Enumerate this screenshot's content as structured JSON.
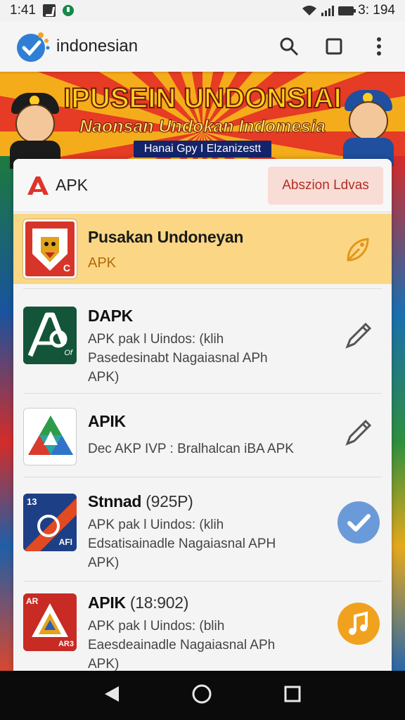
{
  "status_bar": {
    "time": "1:41",
    "clock_right": "3: 194",
    "icons": [
      "notification-icon",
      "whatsapp-icon",
      "wifi-icon",
      "signal-icon",
      "battery-icon"
    ]
  },
  "app_bar": {
    "title": "indonesian",
    "icons": [
      "app-logo-icon",
      "search-icon",
      "square-icon",
      "more-vert-icon"
    ]
  },
  "banner": {
    "title_line1": "IPUSEIN UNDONSIAI",
    "title_line2": "Naonsan Undokan Indomesia",
    "subtitle": "Hanai Gpy I Elzanizestt"
  },
  "card": {
    "header_label": "APK",
    "header_button": "Abszion Ldvas",
    "items": [
      {
        "title": "Pusakan Undoneyan",
        "suffix": "",
        "desc": [
          "APK"
        ],
        "action_icon": "tag-icon",
        "highlighted": true
      },
      {
        "title": "DAPK",
        "suffix": "",
        "desc": [
          "APK  pak l Uindos: (klih",
          "Pasedesinabt Nagaiasnal APh",
          "APK)"
        ],
        "action_icon": "pencil-icon"
      },
      {
        "title": "APIK",
        "suffix": "",
        "desc": [
          "Dec AKP IVP : Bralhalcan iBA APK"
        ],
        "action_icon": "pencil-icon"
      },
      {
        "title": "Stnnad",
        "suffix": "(925P)",
        "desc": [
          "APK  pak l Uindos: (klih",
          "Edsatisainadle Nagaiasnal APH",
          "APK)"
        ],
        "action_icon": "check-circle-icon"
      },
      {
        "title": "APIK",
        "suffix": "(18:902)",
        "desc": [
          "APK  pak l Uindos: (blih",
          "Eaesdeainadle Nagaiasnal APh",
          "APK)"
        ],
        "action_icon": "music-note-icon"
      }
    ],
    "thumb_labels": {
      "item1": "C",
      "item2": "Of",
      "item4_top": "13",
      "item4_bottom": "AFI",
      "item5_top": "AR",
      "item5_bottom": "AR3"
    }
  },
  "nav_bar": {
    "icons": [
      "back-icon",
      "home-icon",
      "recents-icon"
    ]
  },
  "colors": {
    "highlight": "#fbd785",
    "accent_red": "#b22d22",
    "check_blue": "#6b9ad8",
    "music_orange": "#f0a21e"
  }
}
